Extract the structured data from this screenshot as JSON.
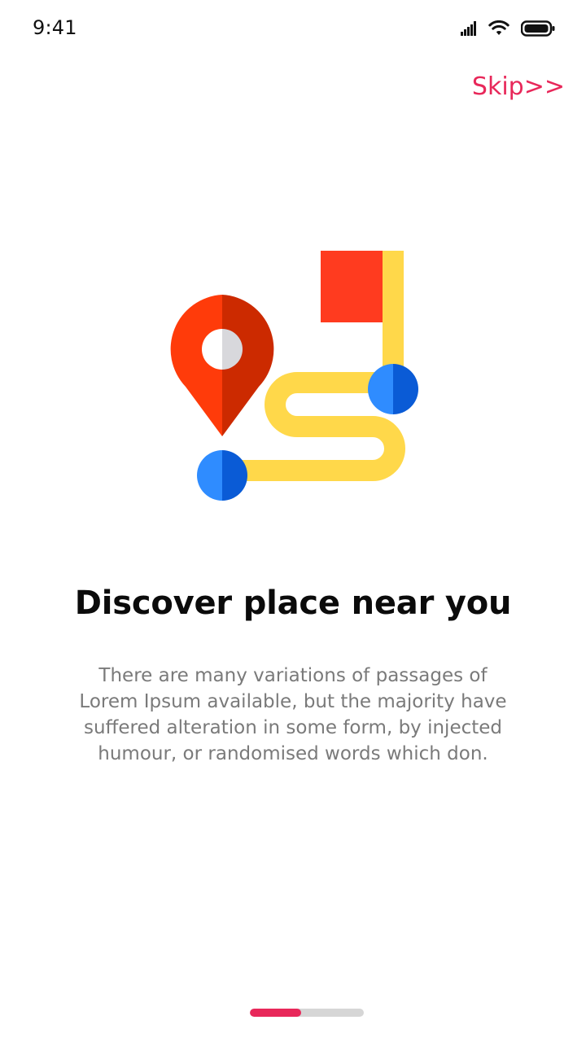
{
  "status_bar": {
    "time": "9:41",
    "icons": [
      "signal-icon",
      "wifi-icon",
      "battery-icon"
    ]
  },
  "skip": {
    "label": "Skip>>",
    "color": "#e8285a"
  },
  "onboarding": {
    "illustration": [
      "map-pin-icon",
      "route-path-illustration",
      "flag-icon"
    ],
    "title": "Discover place near you",
    "description": "There are many variations of passages of Lorem Ipsum available, but the majority have suffered alteration in some form, by injected humour, or randomised words which don.",
    "progress": 0.45,
    "progress_color": "#e8285a",
    "track_color": "#d6d6d6"
  }
}
